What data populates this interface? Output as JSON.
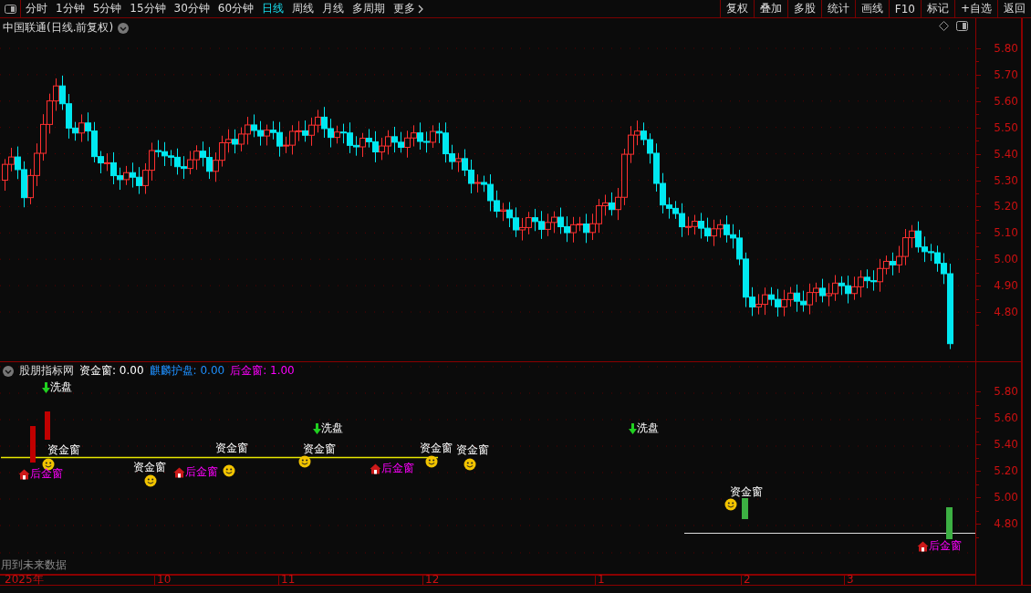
{
  "toolbar": {
    "periods": [
      {
        "label": "分时",
        "selected": false
      },
      {
        "label": "1分钟",
        "selected": false
      },
      {
        "label": "5分钟",
        "selected": false
      },
      {
        "label": "15分钟",
        "selected": false
      },
      {
        "label": "30分钟",
        "selected": false
      },
      {
        "label": "60分钟",
        "selected": false
      },
      {
        "label": "日线",
        "selected": true
      },
      {
        "label": "周线",
        "selected": false
      },
      {
        "label": "月线",
        "selected": false
      },
      {
        "label": "多周期",
        "selected": false
      }
    ],
    "more": "更多",
    "actions": [
      "复权",
      "叠加",
      "多股",
      "统计",
      "画线",
      "F10",
      "标记",
      "+自选",
      "返回"
    ]
  },
  "main_chart": {
    "title": "中国联通(日线.前复权)",
    "price_axis": [
      "5.80",
      "5.70",
      "5.60",
      "5.50",
      "5.40",
      "5.30",
      "5.20",
      "5.10",
      "5.00",
      "4.90",
      "4.80"
    ]
  },
  "indicator": {
    "source": "股朋指标网",
    "values": [
      {
        "text": "资金窗: 0.00",
        "color": "#ffffff"
      },
      {
        "text": "麒麟护盘: 0.00",
        "color": "#1e90ff"
      },
      {
        "text": "后金窗: 1.00",
        "color": "#ff00ff"
      }
    ],
    "axis": [
      "5.80",
      "5.60",
      "5.40",
      "5.20",
      "5.00",
      "4.80"
    ],
    "markers": [
      {
        "kind": "wash",
        "text": "洗盘"
      },
      {
        "kind": "wash",
        "text": "洗盘"
      },
      {
        "kind": "wash",
        "text": "洗盘"
      },
      {
        "kind": "fund",
        "text": "资金窗"
      },
      {
        "kind": "fund",
        "text": "资金窗"
      },
      {
        "kind": "fund",
        "text": "资金窗"
      },
      {
        "kind": "fund",
        "text": "资金窗"
      },
      {
        "kind": "fund",
        "text": "资金窗"
      },
      {
        "kind": "fund",
        "text": "资金窗"
      },
      {
        "kind": "fund",
        "text": "资金窗"
      },
      {
        "kind": "smiley"
      },
      {
        "kind": "smiley"
      },
      {
        "kind": "smiley"
      },
      {
        "kind": "smiley"
      },
      {
        "kind": "smiley"
      },
      {
        "kind": "smiley"
      },
      {
        "kind": "smiley"
      },
      {
        "kind": "gold",
        "text": "后金窗"
      },
      {
        "kind": "gold",
        "text": "后金窗"
      },
      {
        "kind": "gold",
        "text": "后金窗"
      },
      {
        "kind": "gold",
        "text": "后金窗"
      },
      {
        "kind": "bar",
        "color": "#c00000"
      },
      {
        "kind": "bar",
        "color": "#c00000"
      },
      {
        "kind": "bar",
        "color": "#3cb043"
      },
      {
        "kind": "bar",
        "color": "#3cb043"
      }
    ],
    "note": "用到未来数据"
  },
  "date_axis": [
    "2025年",
    "10",
    "11",
    "12",
    "1",
    "2",
    "3"
  ]
}
